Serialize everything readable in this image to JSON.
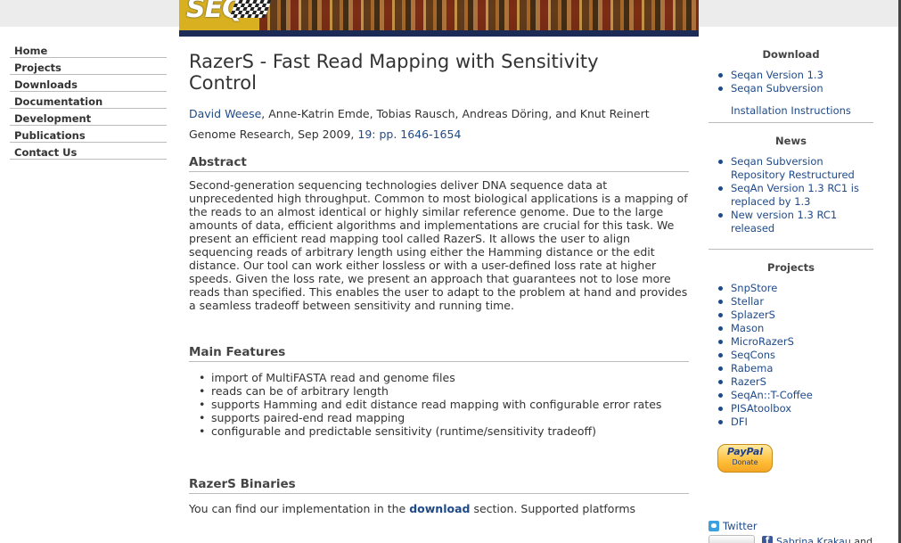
{
  "nav": {
    "items": [
      "Home",
      "Projects",
      "Downloads",
      "Documentation",
      "Development",
      "Publications",
      "Contact Us"
    ]
  },
  "banner": {
    "logo_text": "SEQ"
  },
  "main": {
    "title": "RazerS - Fast Read Mapping with Sensitivity Control",
    "authors": {
      "first_author": "David Weese",
      "rest": ", Anne-Katrin Emde, Tobias Rausch, Andreas Döring, and Knut Reinert"
    },
    "journal": {
      "text": "Genome Research, Sep 2009, ",
      "link": "19: pp. 1646-1654"
    },
    "abstract_heading": "Abstract",
    "abstract": "Second-generation sequencing technologies deliver DNA sequence data at unprecedented high throughput. Common to most biological applications is a mapping of the reads to an almost identical or highly similar reference genome. Due to the large amounts of data, efficient algorithms and implementations are crucial for this task. We present an efficient read mapping tool called RazerS. It allows the user to align sequencing reads of arbitrary length using either the Hamming distance or the edit distance. Our tool can work either lossless or with a user-defined loss rate at higher speeds. Given the loss rate, we present an approach that guarantees not to lose more reads than specified. This enables the user to adapt to the problem at hand and provides a seamless tradeoff between sensitivity and running time.",
    "features_heading": "Main Features",
    "features": [
      "import of MultiFASTA read and genome files",
      "reads can be of arbitrary length",
      "supports Hamming and edit distance read mapping with configurable error rates",
      "supports paired-end read mapping",
      "configurable and predictable sensitivity (runtime/sensitivity tradeoff)"
    ],
    "binaries_heading": "RazerS Binaries",
    "binaries_text_before": "You can find our implementation in the ",
    "binaries_link": "download",
    "binaries_text_after": " section. Supported platforms"
  },
  "sidebar": {
    "download_title": "Download",
    "download_items": [
      "Seqan Version 1.3",
      "Seqan Subversion"
    ],
    "install_link": "Installation Instructions",
    "news_title": "News",
    "news_items": [
      "Seqan Subversion Repository Restructured",
      "SeqAn Version 1.3 RC1 is replaced by 1.3",
      "New version 1.3 RC1 released"
    ],
    "projects_title": "Projects",
    "project_items": [
      "SnpStore",
      "Stellar",
      "SplazerS",
      "Mason",
      "MicroRazerS",
      "SeqCons",
      "Rabema",
      "RazerS",
      "SeqAn::T-Coffee",
      "PISAtoolbox",
      "DFI"
    ],
    "paypal_label": "PayPal",
    "donate_label": "Donate",
    "twitter_label": "Twitter",
    "facebook_name": "Sabrina Krakau",
    "facebook_rest": " and"
  },
  "colors": {
    "link": "#1f4a8a",
    "banner_bar": "#1b2b55"
  }
}
